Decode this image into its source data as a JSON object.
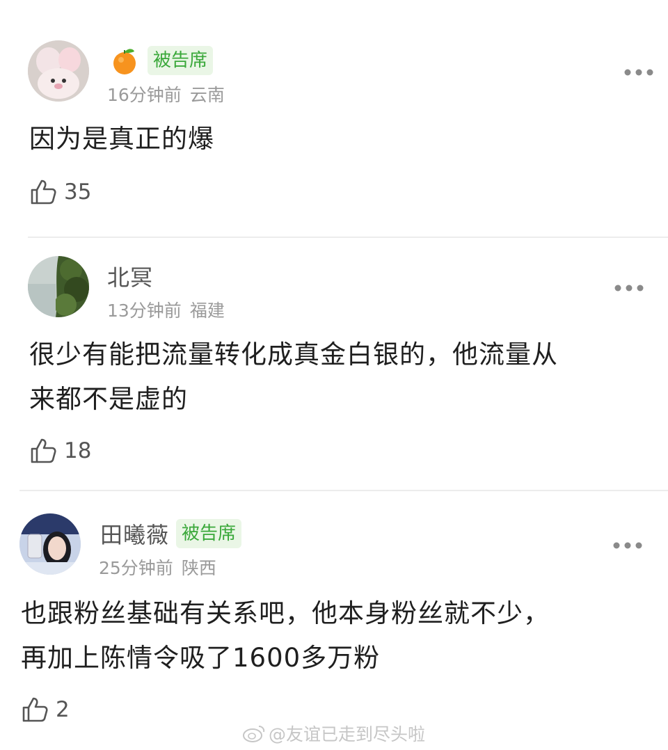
{
  "comments": [
    {
      "username": "",
      "badge": "被告席",
      "time": "16分钟前",
      "location": "云南",
      "text_lines": [
        "因为是真正的爆"
      ],
      "likes": "35",
      "avatar_icon": "plush-toy-avatar"
    },
    {
      "username": "北冥",
      "badge": "",
      "time": "13分钟前",
      "location": "福建",
      "text_lines": [
        "很少有能把流量转化成真金白银的，他流量从",
        "来都不是虚的"
      ],
      "likes": "18",
      "avatar_icon": "forest-avatar"
    },
    {
      "username": "田曦薇",
      "badge": "被告席",
      "time": "25分钟前",
      "location": "陕西",
      "text_lines": [
        "也跟粉丝基础有关系吧，他本身粉丝就不少，",
        "再加上陈情令吸了1600多万粉"
      ],
      "likes": "2",
      "avatar_icon": "selfie-avatar"
    }
  ],
  "watermark": "@友谊已走到尽头啦",
  "colors": {
    "badge_text": "#3aa83a",
    "badge_bg": "#eaf6e6",
    "meta": "#9a9a9a",
    "body_text": "#1f1f1f"
  }
}
